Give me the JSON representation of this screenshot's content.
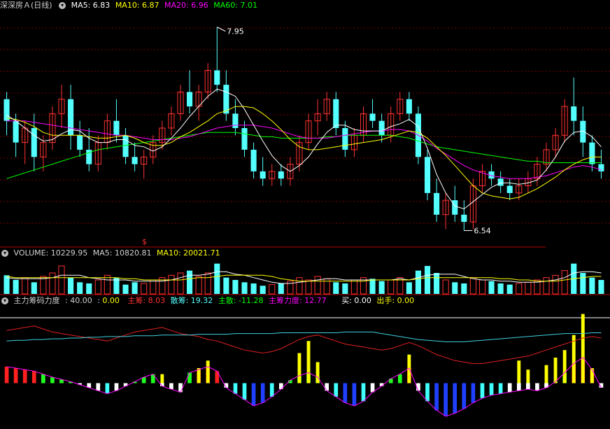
{
  "colors": {
    "up": "#ff3232",
    "down": "#54ffff",
    "ma5": "#ffffff",
    "ma10": "#ffff00",
    "ma20": "#ff00ff",
    "ma60": "#00ff00",
    "grid": "#7a0000",
    "divider": "#b00000"
  },
  "price_panel": {
    "stock_name": "深深房Ａ(日线)",
    "ma5": "MA5: 6.83",
    "ma10": "MA10: 6.87",
    "ma20": "MA20: 6.96",
    "ma60": "MA60: 7.01",
    "high_marker": "7.95",
    "low_marker": "6.54",
    "event_marker": "$"
  },
  "volume_panel": {
    "label": "VOLUME: 10229.95",
    "ma5": "MA5: 10820.81",
    "ma10": "MA10: 20021.71"
  },
  "indicator_panel": {
    "name": "主力筹码力度",
    "value1": "40.00",
    "value2": "0.00",
    "zhuchou": "主筹: 8.03",
    "sanchou": "散筹: 19.32",
    "zhusan": "主散: -11.28",
    "zhuchou_lidu": "主筹力度: 12.77",
    "buy": "买: 0.00",
    "sell": "出手: 0.00"
  },
  "chart_data": [
    {
      "type": "candlestick",
      "title": "深深房Ａ(日线)",
      "ohlc": [
        [
          7.45,
          7.5,
          7.2,
          7.3
        ],
        [
          7.3,
          7.35,
          7.05,
          7.15
        ],
        [
          7.15,
          7.3,
          7.0,
          7.25
        ],
        [
          7.25,
          7.35,
          6.95,
          7.05
        ],
        [
          7.05,
          7.2,
          6.95,
          7.15
        ],
        [
          7.15,
          7.4,
          7.1,
          7.35
        ],
        [
          7.35,
          7.55,
          7.25,
          7.45
        ],
        [
          7.45,
          7.55,
          7.1,
          7.2
        ],
        [
          7.2,
          7.3,
          7.05,
          7.1
        ],
        [
          7.1,
          7.25,
          6.95,
          7.0
        ],
        [
          7.0,
          7.2,
          6.95,
          7.15
        ],
        [
          7.15,
          7.35,
          7.1,
          7.3
        ],
        [
          7.3,
          7.45,
          7.15,
          7.2
        ],
        [
          7.2,
          7.25,
          7.0,
          7.05
        ],
        [
          7.05,
          7.15,
          6.95,
          7.0
        ],
        [
          7.0,
          7.1,
          6.9,
          7.05
        ],
        [
          7.05,
          7.2,
          7.0,
          7.15
        ],
        [
          7.15,
          7.3,
          7.1,
          7.25
        ],
        [
          7.25,
          7.4,
          7.2,
          7.35
        ],
        [
          7.35,
          7.55,
          7.3,
          7.5
        ],
        [
          7.5,
          7.65,
          7.35,
          7.4
        ],
        [
          7.4,
          7.55,
          7.3,
          7.5
        ],
        [
          7.5,
          7.7,
          7.45,
          7.65
        ],
        [
          7.65,
          7.95,
          7.5,
          7.55
        ],
        [
          7.55,
          7.65,
          7.3,
          7.35
        ],
        [
          7.35,
          7.45,
          7.2,
          7.25
        ],
        [
          7.25,
          7.3,
          7.05,
          7.1
        ],
        [
          7.1,
          7.15,
          6.9,
          6.95
        ],
        [
          6.95,
          7.05,
          6.85,
          6.9
        ],
        [
          6.9,
          7.0,
          6.85,
          6.95
        ],
        [
          6.95,
          7.0,
          6.85,
          6.9
        ],
        [
          6.9,
          7.05,
          6.85,
          7.0
        ],
        [
          7.0,
          7.2,
          6.95,
          7.15
        ],
        [
          7.15,
          7.35,
          7.1,
          7.3
        ],
        [
          7.3,
          7.45,
          7.2,
          7.35
        ],
        [
          7.35,
          7.5,
          7.3,
          7.45
        ],
        [
          7.45,
          7.5,
          7.2,
          7.25
        ],
        [
          7.25,
          7.3,
          7.05,
          7.1
        ],
        [
          7.1,
          7.25,
          7.05,
          7.2
        ],
        [
          7.2,
          7.4,
          7.15,
          7.35
        ],
        [
          7.35,
          7.45,
          7.25,
          7.3
        ],
        [
          7.3,
          7.35,
          7.15,
          7.2
        ],
        [
          7.2,
          7.4,
          7.15,
          7.35
        ],
        [
          7.35,
          7.5,
          7.3,
          7.45
        ],
        [
          7.45,
          7.5,
          7.3,
          7.35
        ],
        [
          7.35,
          7.4,
          7.0,
          7.05
        ],
        [
          7.05,
          7.1,
          6.75,
          6.8
        ],
        [
          6.8,
          6.9,
          6.6,
          6.65
        ],
        [
          6.65,
          6.8,
          6.55,
          6.75
        ],
        [
          6.75,
          6.85,
          6.6,
          6.65
        ],
        [
          6.65,
          6.75,
          6.54,
          6.6
        ],
        [
          6.6,
          6.9,
          6.55,
          6.85
        ],
        [
          6.85,
          7.0,
          6.8,
          6.95
        ],
        [
          6.95,
          7.0,
          6.85,
          6.9
        ],
        [
          6.9,
          6.95,
          6.8,
          6.85
        ],
        [
          6.85,
          6.9,
          6.75,
          6.8
        ],
        [
          6.8,
          6.9,
          6.75,
          6.85
        ],
        [
          6.85,
          6.95,
          6.8,
          6.9
        ],
        [
          6.9,
          7.05,
          6.85,
          7.0
        ],
        [
          7.0,
          7.15,
          6.95,
          7.1
        ],
        [
          7.1,
          7.25,
          7.05,
          7.2
        ],
        [
          7.2,
          7.45,
          7.15,
          7.4
        ],
        [
          7.4,
          7.6,
          7.2,
          7.3
        ],
        [
          7.3,
          7.4,
          7.05,
          7.15
        ],
        [
          7.15,
          7.2,
          6.95,
          7.0
        ],
        [
          7.0,
          7.1,
          6.9,
          6.95
        ]
      ],
      "ma5": [
        7.34,
        7.3,
        7.25,
        7.2,
        7.16,
        7.17,
        7.21,
        7.24,
        7.23,
        7.18,
        7.15,
        7.15,
        7.17,
        7.17,
        7.13,
        7.12,
        7.09,
        7.12,
        7.18,
        7.25,
        7.33,
        7.4,
        7.47,
        7.52,
        7.5,
        7.47,
        7.38,
        7.27,
        7.16,
        7.06,
        6.99,
        6.95,
        6.99,
        7.05,
        7.14,
        7.22,
        7.27,
        7.27,
        7.24,
        7.23,
        7.23,
        7.23,
        7.26,
        7.28,
        7.31,
        7.26,
        7.11,
        6.93,
        6.8,
        6.71,
        6.69,
        6.74,
        6.79,
        6.84,
        6.87,
        6.87,
        6.86,
        6.87,
        6.89,
        6.96,
        7.05,
        7.16,
        7.22,
        7.23,
        7.19,
        7.12
      ],
      "ma10": [
        7.32,
        7.31,
        7.29,
        7.26,
        7.22,
        7.2,
        7.2,
        7.2,
        7.2,
        7.19,
        7.18,
        7.18,
        7.19,
        7.2,
        7.18,
        7.15,
        7.13,
        7.13,
        7.15,
        7.19,
        7.22,
        7.26,
        7.3,
        7.35,
        7.37,
        7.4,
        7.4,
        7.39,
        7.35,
        7.3,
        7.24,
        7.17,
        7.12,
        7.1,
        7.1,
        7.11,
        7.12,
        7.13,
        7.14,
        7.15,
        7.16,
        7.17,
        7.19,
        7.21,
        7.23,
        7.22,
        7.18,
        7.12,
        7.06,
        6.99,
        6.92,
        6.85,
        6.8,
        6.78,
        6.77,
        6.76,
        6.77,
        6.8,
        6.83,
        6.87,
        6.91,
        6.96,
        7.0,
        7.03,
        7.05,
        7.05
      ],
      "ma20": [
        7.3,
        7.3,
        7.3,
        7.29,
        7.28,
        7.27,
        7.26,
        7.25,
        7.24,
        7.23,
        7.22,
        7.21,
        7.2,
        7.2,
        7.19,
        7.18,
        7.17,
        7.17,
        7.17,
        7.18,
        7.19,
        7.21,
        7.23,
        7.25,
        7.26,
        7.27,
        7.27,
        7.27,
        7.26,
        7.25,
        7.23,
        7.21,
        7.19,
        7.18,
        7.18,
        7.18,
        7.19,
        7.2,
        7.21,
        7.22,
        7.23,
        7.23,
        7.24,
        7.24,
        7.23,
        7.2,
        7.16,
        7.11,
        7.07,
        7.03,
        6.99,
        6.96,
        6.94,
        6.92,
        6.91,
        6.9,
        6.9,
        6.9,
        6.91,
        6.92,
        6.94,
        6.96,
        6.98,
        6.99,
        6.98,
        6.96
      ],
      "ma60": [
        6.9,
        6.92,
        6.94,
        6.96,
        6.98,
        7.0,
        7.02,
        7.04,
        7.06,
        7.08,
        7.1,
        7.11,
        7.12,
        7.13,
        7.14,
        7.15,
        7.16,
        7.17,
        7.18,
        7.19,
        7.2,
        7.21,
        7.22,
        7.22,
        7.22,
        7.22,
        7.21,
        7.2,
        7.19,
        7.19,
        7.18,
        7.18,
        7.18,
        7.18,
        7.18,
        7.19,
        7.19,
        7.2,
        7.2,
        7.2,
        7.2,
        7.2,
        7.2,
        7.19,
        7.18,
        7.16,
        7.14,
        7.12,
        7.11,
        7.1,
        7.09,
        7.08,
        7.07,
        7.06,
        7.05,
        7.04,
        7.03,
        7.02,
        7.02,
        7.01,
        7.01,
        7.01,
        7.01,
        7.01,
        7.01,
        7.01
      ],
      "price_range": [
        6.45,
        8.05
      ],
      "grid": true
    },
    {
      "type": "bar",
      "title": "VOLUME",
      "values": [
        16,
        12,
        14,
        10,
        15,
        18,
        24,
        14,
        10,
        9,
        12,
        16,
        14,
        8,
        10,
        9,
        12,
        14,
        16,
        18,
        20,
        15,
        18,
        26,
        14,
        12,
        10,
        9,
        7,
        8,
        9,
        11,
        14,
        12,
        15,
        13,
        10,
        9,
        12,
        14,
        13,
        11,
        12,
        14,
        10,
        20,
        24,
        18,
        12,
        10,
        9,
        14,
        12,
        11,
        9,
        8,
        9,
        10,
        12,
        14,
        16,
        20,
        26,
        18,
        14,
        12
      ],
      "ma5": [
        14,
        13,
        13,
        13,
        13,
        14,
        16,
        16,
        16,
        14,
        13,
        12,
        12,
        12,
        11,
        11,
        11,
        11,
        12,
        14,
        16,
        16,
        17,
        19,
        19,
        17,
        16,
        14,
        12,
        10,
        9,
        9,
        10,
        11,
        12,
        13,
        13,
        12,
        12,
        12,
        12,
        12,
        12,
        13,
        12,
        14,
        16,
        17,
        17,
        17,
        15,
        13,
        12,
        12,
        11,
        11,
        10,
        10,
        10,
        11,
        12,
        14,
        18,
        19,
        19,
        18
      ],
      "ma10": [
        15,
        14,
        14,
        14,
        14,
        14,
        14,
        14,
        14,
        14,
        14,
        14,
        14,
        13,
        13,
        12,
        12,
        12,
        12,
        12,
        13,
        14,
        14,
        15,
        16,
        16,
        16,
        16,
        16,
        15,
        13,
        12,
        11,
        11,
        11,
        11,
        11,
        11,
        11,
        11,
        12,
        12,
        12,
        12,
        12,
        13,
        14,
        14,
        14,
        14,
        14,
        14,
        14,
        14,
        13,
        13,
        12,
        12,
        11,
        11,
        11,
        12,
        13,
        14,
        15,
        15
      ],
      "ylim": [
        0,
        30
      ]
    },
    {
      "type": "bar",
      "title": "主力筹码力度",
      "values": [
        22,
        20,
        18,
        16,
        12,
        8,
        5,
        2,
        -2,
        -6,
        -10,
        -14,
        -10,
        -4,
        2,
        8,
        12,
        -4,
        -8,
        -12,
        14,
        18,
        22,
        16,
        -6,
        -14,
        -22,
        -30,
        -26,
        -18,
        -8,
        4,
        10,
        14,
        8,
        -10,
        -18,
        -26,
        -30,
        -24,
        -12,
        -4,
        6,
        12,
        20,
        -10,
        -24,
        -36,
        -44,
        -40,
        -34,
        -26,
        -20,
        -16,
        -14,
        -12,
        -10,
        -8,
        -10,
        -6,
        2,
        14,
        26,
        34,
        18,
        -6
      ],
      "spikes": [
        0,
        0,
        0,
        0,
        0,
        0,
        0,
        0,
        0,
        0,
        0,
        0,
        0,
        0,
        0,
        0,
        0,
        12,
        0,
        0,
        0,
        20,
        30,
        0,
        0,
        0,
        0,
        0,
        0,
        0,
        0,
        0,
        40,
        56,
        28,
        0,
        0,
        0,
        0,
        0,
        0,
        0,
        0,
        0,
        38,
        0,
        0,
        0,
        0,
        0,
        0,
        0,
        0,
        0,
        0,
        0,
        30,
        18,
        0,
        24,
        34,
        44,
        64,
        92,
        20,
        0
      ],
      "line_main": [
        70,
        72,
        74,
        76,
        72,
        68,
        66,
        64,
        62,
        60,
        58,
        56,
        60,
        64,
        68,
        70,
        72,
        74,
        70,
        66,
        64,
        62,
        58,
        56,
        52,
        48,
        44,
        42,
        40,
        42,
        46,
        52,
        58,
        62,
        64,
        60,
        56,
        52,
        50,
        48,
        46,
        44,
        46,
        50,
        54,
        50,
        44,
        38,
        34,
        30,
        28,
        26,
        26,
        28,
        30,
        32,
        34,
        36,
        40,
        44,
        48,
        52,
        56,
        60,
        62,
        60
      ],
      "line_base": [
        56,
        57,
        57,
        58,
        58,
        59,
        59,
        60,
        60,
        61,
        61,
        62,
        62,
        62,
        63,
        63,
        63,
        64,
        64,
        64,
        64,
        65,
        65,
        65,
        65,
        66,
        66,
        66,
        66,
        66,
        67,
        67,
        67,
        67,
        67,
        67,
        67,
        68,
        68,
        68,
        68,
        66,
        64,
        62,
        60,
        58,
        57,
        56,
        55,
        55,
        55,
        56,
        57,
        58,
        59,
        60,
        61,
        62,
        63,
        64,
        65,
        66,
        66,
        66,
        67,
        67
      ],
      "ylim": [
        -60,
        100
      ]
    }
  ]
}
